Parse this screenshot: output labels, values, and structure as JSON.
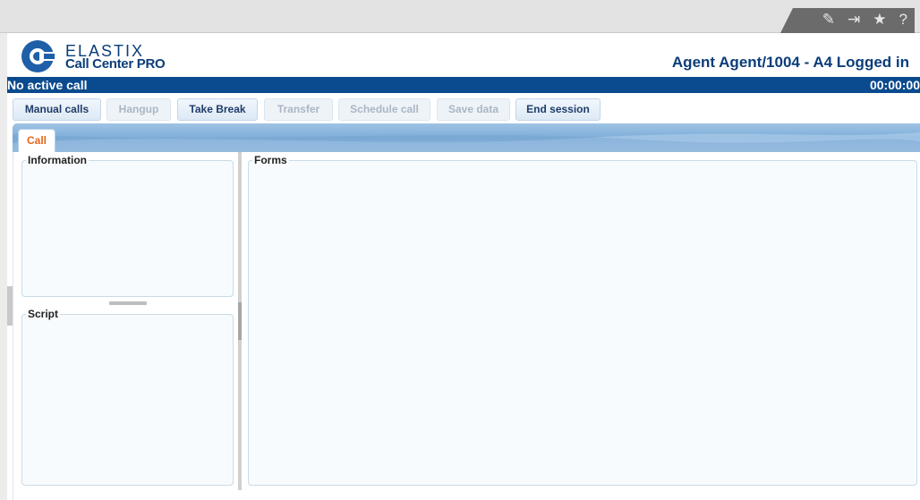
{
  "window": {
    "top_icons": [
      {
        "name": "edit-icon",
        "glyph": "✎"
      },
      {
        "name": "exit-icon",
        "glyph": "⇥"
      },
      {
        "name": "star-icon",
        "glyph": "★"
      },
      {
        "name": "help-icon",
        "glyph": "?"
      }
    ]
  },
  "header": {
    "brand_line1": "ELASTIX",
    "brand_line2": "Call Center PRO",
    "agent_status": "Agent Agent/1004 - A4 Logged in"
  },
  "status": {
    "call_state": "No active call",
    "timer": "00:00:00"
  },
  "toolbar": {
    "buttons": [
      {
        "label": "Manual calls",
        "enabled": true
      },
      {
        "label": "Hangup",
        "enabled": false
      },
      {
        "label": "Take Break",
        "enabled": true
      },
      {
        "label": "Transfer",
        "enabled": false
      },
      {
        "label": "Schedule call",
        "enabled": false
      },
      {
        "label": "Save data",
        "enabled": false
      },
      {
        "label": "End session",
        "enabled": true
      }
    ]
  },
  "tabs": [
    {
      "label": "Call",
      "active": true
    }
  ],
  "panels": {
    "information": "Information",
    "script": "Script",
    "forms": "Forms"
  },
  "colors": {
    "brand_blue": "#0b3d7a",
    "status_bar": "#0a4a8e",
    "active_tab_text": "#e8651b",
    "logo_blue": "#1f5fa8"
  }
}
